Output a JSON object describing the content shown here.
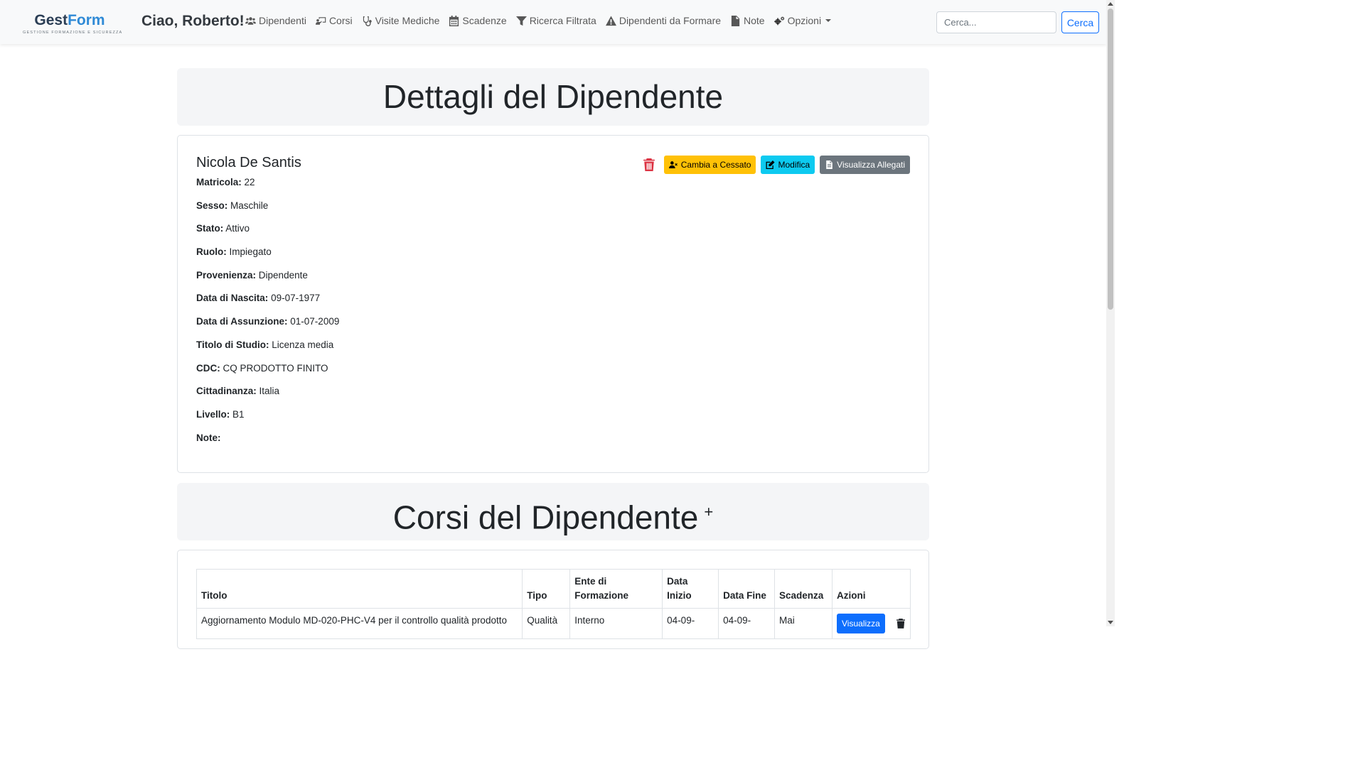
{
  "brand": {
    "name_part1": "Gest",
    "name_part2": "Form",
    "tagline": "GESTIONE FORMAZIONE E SICUREZZA"
  },
  "navbar": {
    "greeting": "Ciao, Roberto!",
    "links": [
      {
        "label": "Dipendenti",
        "icon": "users-icon"
      },
      {
        "label": "Corsi",
        "icon": "chalkboard-teacher-icon"
      },
      {
        "label": "Visite Mediche",
        "icon": "stethoscope-icon"
      },
      {
        "label": "Scadenze",
        "icon": "calendar-icon"
      },
      {
        "label": "Ricerca Filtrata",
        "icon": "filter-icon"
      },
      {
        "label": "Dipendenti da Formare",
        "icon": "warning-icon"
      },
      {
        "label": "Note",
        "icon": "file-icon"
      },
      {
        "label": "Opzioni",
        "icon": "cogs-icon"
      }
    ],
    "search_placeholder": "Cerca...",
    "search_button": "Cerca"
  },
  "details": {
    "heading": "Dettagli del Dipendente",
    "employee_name": "Nicola De Santis",
    "actions": {
      "cessato_label": "Cambia a Cessato",
      "modifica_label": "Modifica",
      "allegati_label": "Visualizza Allegati"
    },
    "fields": [
      {
        "label": "Matricola:",
        "value": "22"
      },
      {
        "label": "Sesso:",
        "value": "Maschile"
      },
      {
        "label": "Stato:",
        "value": "Attivo"
      },
      {
        "label": "Ruolo:",
        "value": "Impiegato"
      },
      {
        "label": "Provenienza:",
        "value": "Dipendente"
      },
      {
        "label": "Data di Nascita:",
        "value": "09-07-1977"
      },
      {
        "label": "Data di Assunzione:",
        "value": "01-07-2009"
      },
      {
        "label": "Titolo di Studio:",
        "value": "Licenza media"
      },
      {
        "label": "CDC:",
        "value": "CQ PRODOTTO FINITO"
      },
      {
        "label": "Cittadinanza:",
        "value": "Italia"
      },
      {
        "label": "Livello:",
        "value": "B1"
      },
      {
        "label": "Note:",
        "value": ""
      }
    ]
  },
  "courses": {
    "heading": "Corsi del Dipendente",
    "add_symbol": "+",
    "columns": [
      "Titolo",
      "Tipo",
      "Ente di Formazione",
      "Data Inizio",
      "Data Fine",
      "Scadenza",
      "Azioni"
    ],
    "rows": [
      {
        "titolo": "Aggiornamento Modulo MD-020-PHC-V4 per il controllo qualità prodotto",
        "tipo": "Qualità",
        "ente": "Interno",
        "data_inizio": "04-09-",
        "data_fine": "04-09-",
        "scadenza": "Mai",
        "view_label": "Visualizza"
      }
    ]
  }
}
